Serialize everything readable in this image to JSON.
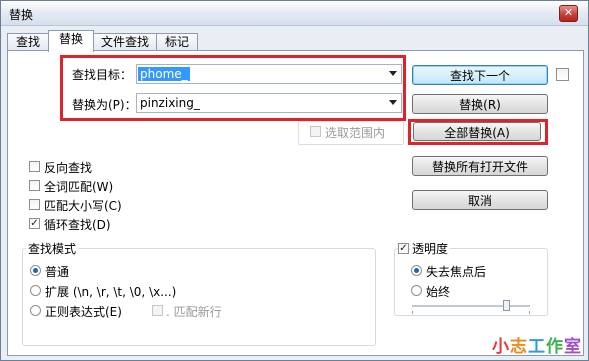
{
  "window": {
    "title": "替换",
    "close_glyph": "✕"
  },
  "tabs": [
    {
      "label": "查找"
    },
    {
      "label": "替换"
    },
    {
      "label": "文件查找"
    },
    {
      "label": "标记"
    }
  ],
  "find": {
    "label": "查找目标：",
    "value": "phome_"
  },
  "replace": {
    "label": "替换为(P)：",
    "value": "pinzixing_"
  },
  "in_selection": {
    "label": "选取范围内"
  },
  "buttons": {
    "find_next": "查找下一个",
    "replace": "替换(R)",
    "replace_all": "全部替换(A)",
    "replace_all_open": "替换所有打开文件",
    "cancel": "取消"
  },
  "options": [
    {
      "label": "反向查找",
      "checked": false
    },
    {
      "label": "全词匹配(W)",
      "checked": false
    },
    {
      "label": "匹配大小写(C)",
      "checked": false
    },
    {
      "label": "循环查找(D)",
      "checked": true
    }
  ],
  "search_mode": {
    "title": "查找模式",
    "normal": "普通",
    "extended": "扩展 (\\n, \\r, \\t, \\0, \\x...)",
    "regex": "正则表达式(E)",
    "dot_newline": ". 匹配新行",
    "selected": "normal"
  },
  "transparency": {
    "title": "透明度",
    "checked": true,
    "on_lose_focus": "失去焦点后",
    "always": "始终",
    "selected": "on_lose_focus",
    "level_fraction": 0.8
  },
  "watermark": {
    "chars": [
      "小",
      "志",
      "工",
      "作",
      "室"
    ],
    "colors": [
      "#e83a3a",
      "#f08a1c",
      "#2e9be0",
      "#3ab54a",
      "#a04fc7"
    ]
  },
  "colors": {
    "highlight_red": "#e0232a",
    "selection_blue": "#3399ff"
  }
}
